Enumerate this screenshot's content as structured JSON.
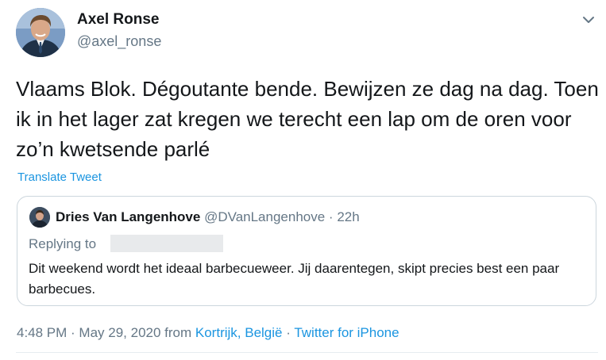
{
  "author": {
    "name": "Axel Ronse",
    "handle": "@axel_ronse"
  },
  "tweet": {
    "text": "Vlaams Blok. Dégoutante bende. Bewijzen ze dag na dag. Toen ik in het lager zat kregen we terecht een lap om de oren voor zo’n kwetsende parlé",
    "translate_label": "Translate Tweet"
  },
  "quoted_tweet": {
    "author_name": "Dries Van Langenhove",
    "handle": "@DVanLangenhove",
    "separator": " · ",
    "time_ago": "22h",
    "replying_to_label": "Replying to",
    "text": "Dit weekend wordt het ideaal barbecueweer. Jij daarentegen, skipt precies best een paar barbecues."
  },
  "footer": {
    "time": "4:48 PM",
    "dot1": " · ",
    "date": "May 29, 2020",
    "from_label": " from ",
    "location": "Kortrijk, België",
    "dot2": " · ",
    "client": "Twitter for iPhone"
  },
  "colors": {
    "link": "#1b95e0",
    "secondary_text": "#657786",
    "border": "#ccd6dd"
  },
  "icons": {
    "menu": "chevron-down-icon"
  }
}
